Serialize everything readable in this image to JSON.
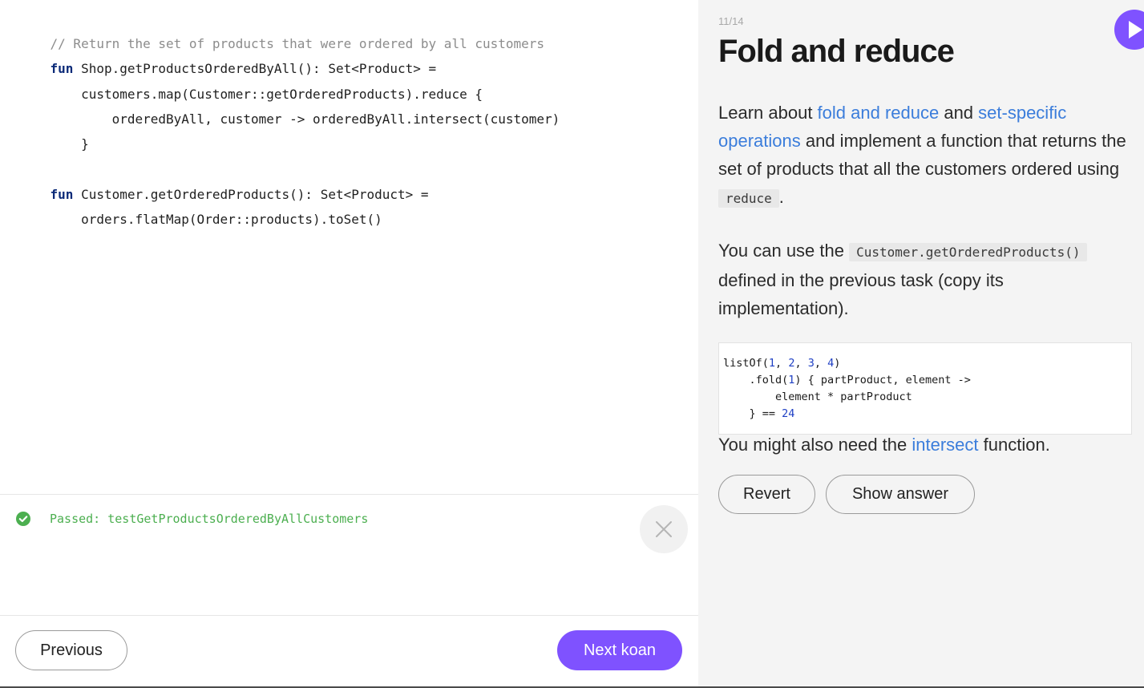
{
  "editor": {
    "lines": [
      {
        "parts": [
          {
            "t": "// Return the set of products that were ordered by all customers",
            "c": "comment"
          }
        ]
      },
      {
        "parts": [
          {
            "t": "fun",
            "c": "kw"
          },
          {
            "t": " Shop.getProductsOrderedByAll(): Set<Product> =",
            "c": ""
          }
        ]
      },
      {
        "parts": [
          {
            "t": "    customers.map(Customer::getOrderedProducts).reduce {",
            "c": ""
          }
        ]
      },
      {
        "parts": [
          {
            "t": "        orderedByAll, customer -> orderedByAll.intersect(customer)",
            "c": ""
          }
        ]
      },
      {
        "parts": [
          {
            "t": "    }",
            "c": ""
          }
        ]
      },
      {
        "parts": [
          {
            "t": "",
            "c": ""
          }
        ]
      },
      {
        "parts": [
          {
            "t": "fun",
            "c": "kw"
          },
          {
            "t": " Customer.getOrderedProducts(): Set<Product> =",
            "c": ""
          }
        ]
      },
      {
        "parts": [
          {
            "t": "    orders.flatMap(Order::products).toSet()",
            "c": ""
          }
        ]
      }
    ]
  },
  "output": {
    "status_text": "Passed: testGetProductsOrderedByAllCustomers",
    "status_color": "#4caf50"
  },
  "footer": {
    "previous_label": "Previous",
    "next_label": "Next koan"
  },
  "task": {
    "counter": "11/14",
    "title": "Fold and reduce",
    "para1": {
      "t1": "Learn about ",
      "link1": "fold and reduce",
      "t2": " and ",
      "link2": "set-specific operations",
      "t3": " and implement a function that returns the set of products that all the customers ordered using ",
      "code": "reduce",
      "t4": "."
    },
    "para2": {
      "t1": "You can use the ",
      "code": "Customer.getOrderedProducts()",
      "t2": " defined in the previous task (copy its implementation)."
    },
    "example_lines": [
      [
        {
          "t": "listOf(",
          "c": ""
        },
        {
          "t": "1",
          "c": "num"
        },
        {
          "t": ", ",
          "c": ""
        },
        {
          "t": "2",
          "c": "num"
        },
        {
          "t": ", ",
          "c": ""
        },
        {
          "t": "3",
          "c": "num"
        },
        {
          "t": ", ",
          "c": ""
        },
        {
          "t": "4",
          "c": "num"
        },
        {
          "t": ")",
          "c": ""
        }
      ],
      [
        {
          "t": "    .fold(",
          "c": ""
        },
        {
          "t": "1",
          "c": "num"
        },
        {
          "t": ") { partProduct, element ->",
          "c": ""
        }
      ],
      [
        {
          "t": "        element * partProduct",
          "c": ""
        }
      ],
      [
        {
          "t": "    } == ",
          "c": ""
        },
        {
          "t": "24",
          "c": "num"
        }
      ]
    ],
    "para3": {
      "t1": "You might also need the ",
      "link": "intersect",
      "t2": " function."
    },
    "revert_label": "Revert",
    "show_answer_label": "Show answer"
  },
  "colors": {
    "accent": "#7f52ff",
    "link": "#3b7ddb",
    "panel_bg": "#f4f4f4"
  },
  "icons": {
    "run": "play-icon",
    "status": "check-circle-icon",
    "close": "close-icon"
  }
}
